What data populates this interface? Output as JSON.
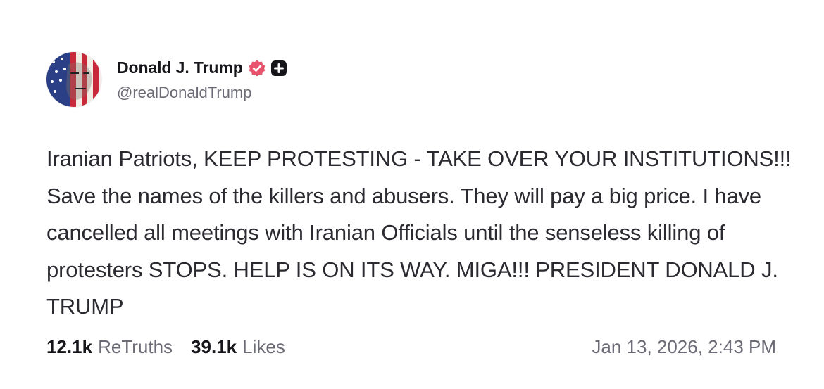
{
  "author": {
    "display_name": "Donald J. Trump",
    "handle": "@realDonaldTrump",
    "avatar_icon": "american-flag-portrait-avatar",
    "verified_icon": "verified-badge-icon",
    "badge_icon": "plus-badge-icon"
  },
  "post": {
    "text": "Iranian Patriots, KEEP PROTESTING - TAKE OVER YOUR INSTITUTIONS!!! Save the names of the killers and abusers. They will pay a big price. I have cancelled all meetings with Iranian Officials until the senseless killing of protesters STOPS. HELP IS ON ITS WAY. MIGA!!! PRESIDENT DONALD J. TRUMP"
  },
  "stats": {
    "retruths_count": "12.1k",
    "retruths_label": "ReTruths",
    "likes_count": "39.1k",
    "likes_label": "Likes"
  },
  "timestamp": "Jan 13, 2026, 2:43 PM",
  "colors": {
    "verified_badge": "#e8546d",
    "plus_badge": "#15151a",
    "muted_text": "#6b6b76",
    "body_text": "#2a2a30"
  }
}
